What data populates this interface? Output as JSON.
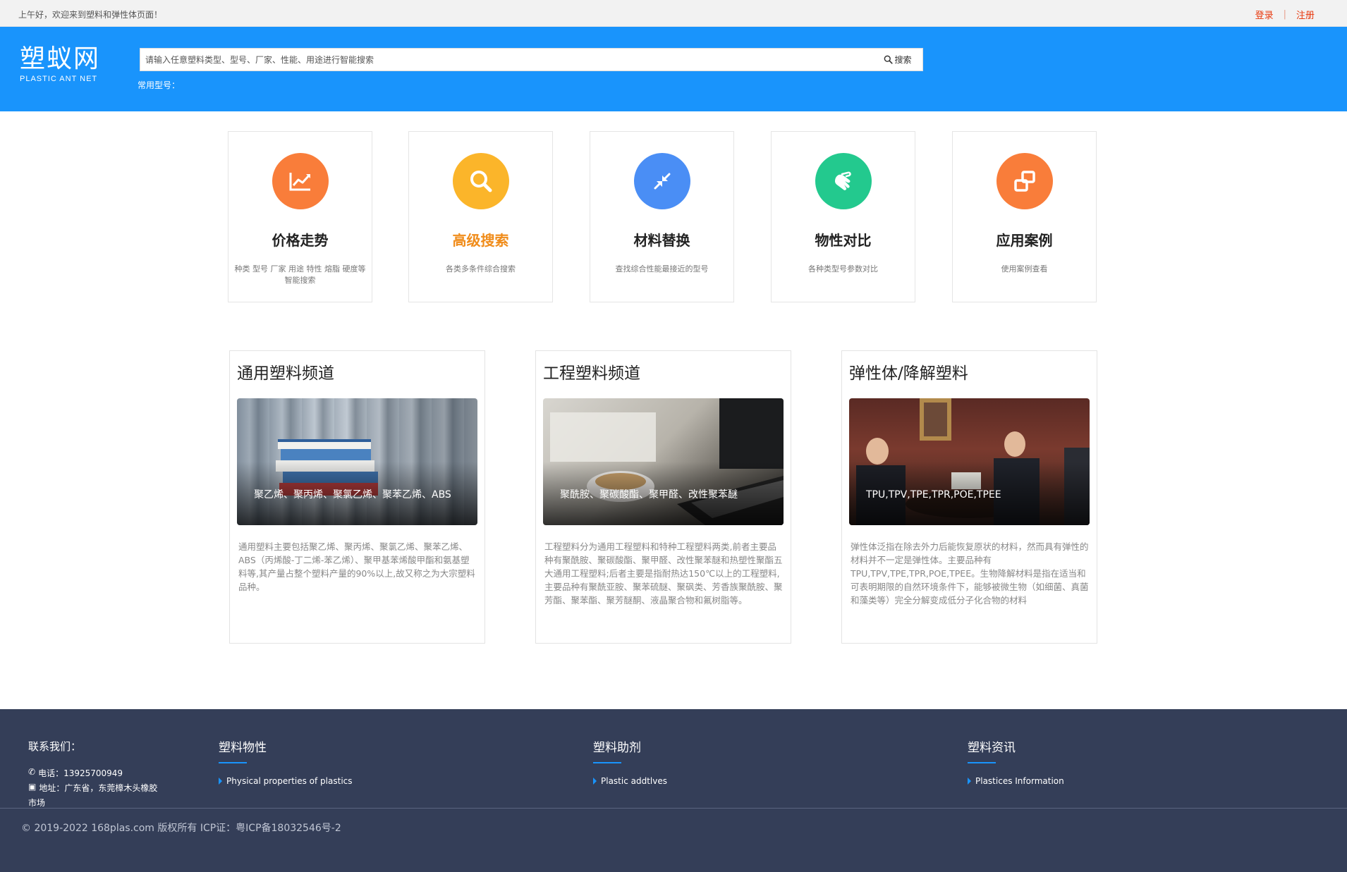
{
  "topbar": {
    "greeting": "上午好，欢迎来到塑料和弹性体页面！",
    "login": "登录",
    "separator": "|",
    "register": "注册"
  },
  "header": {
    "logo_cn": "塑蚁网",
    "logo_en": "PLASTIC ANT NET",
    "search_placeholder": "请输入任意塑料类型、型号、厂家、性能、用途进行智能搜索",
    "search_button": "搜索",
    "common_models_label": "常用型号："
  },
  "features": [
    {
      "title": "价格走势",
      "desc": "种类 型号 厂家 用途 特性 熔脂 硬度等智能搜索",
      "color": "#f97d3a",
      "icon": "chart-line-icon"
    },
    {
      "title": "高级搜索",
      "desc": "各类多条件综合搜索",
      "color": "#fbb52a",
      "icon": "search-icon"
    },
    {
      "title": "材料替换",
      "desc": "查找综合性能最接近的型号",
      "color": "#4a8ef5",
      "icon": "compress-arrows-icon"
    },
    {
      "title": "物性对比",
      "desc": "各种类型号参数对比",
      "color": "#23c98e",
      "icon": "hands-icon"
    },
    {
      "title": "应用案例",
      "desc": "使用案例查看",
      "color": "#f97d3a",
      "icon": "clone-icon"
    }
  ],
  "channels": [
    {
      "title": "通用塑料频道",
      "image_caption": "聚乙烯、聚丙烯、聚氯乙烯、聚苯乙烯、ABS",
      "desc": "通用塑料主要包括聚乙烯、聚丙烯、聚氯乙烯、聚苯乙烯、ABS（丙烯酸-丁二烯-苯乙烯）、聚甲基苯烯酸甲酯和氨基塑料等,其产量占整个塑料产量的90%以上,故又称之为大宗塑料品种。"
    },
    {
      "title": "工程塑料频道",
      "image_caption": "聚酰胺、聚碳酸酯、聚甲醛、改性聚苯醚",
      "desc": "工程塑料分为通用工程塑料和特种工程塑料两类,前者主要品种有聚酰胺、聚碳酸酯、聚甲醛、改性聚苯醚和热塑性聚酯五大通用工程塑料;后者主要是指耐热达150℃以上的工程塑料,主要品种有聚酰亚胺、聚苯硫醚、聚砜类、芳香族聚酰胺、聚芳酯、聚苯酯、聚芳醚酮、液晶聚合物和氟树脂等。"
    },
    {
      "title": "弹性体/降解塑料",
      "image_caption": "TPU,TPV,TPE,TPR,POE,TPEE",
      "desc": "弹性体泛指在除去外力后能恢复原状的材料，然而具有弹性的材料并不一定是弹性体。主要品种有TPU,TPV,TPE,TPR,POE,TPEE。生物降解材料是指在适当和可表明期限的自然环境条件下，能够被微生物（如细菌、真菌和藻类等）完全分解变成低分子化合物的材料"
    }
  ],
  "footer": {
    "contact_title": "联系我们：",
    "phone": "电话：13925700949",
    "address_line1": "地址：广东省，东莞樟木头橡胶",
    "address_line2": "市场",
    "columns": [
      {
        "title": "塑料物性",
        "link": "Physical properties of plastics"
      },
      {
        "title": "塑料助剂",
        "link": "Plastic addtlves"
      },
      {
        "title": "塑料资讯",
        "link": "Plastices Information"
      }
    ],
    "copyright": "© 2019-2022 168plas.com 版权所有 ICP证：粤ICP备18032546号-2"
  },
  "colors": {
    "brand_blue": "#1994fc",
    "footer_bg": "#343e58",
    "login_red": "#e8380d"
  }
}
